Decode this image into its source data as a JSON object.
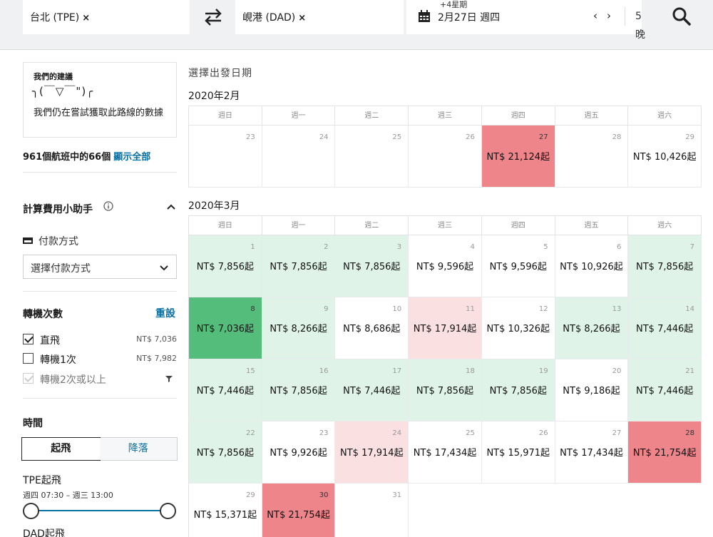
{
  "search": {
    "origin": "台北 (TPE)",
    "destination": "峴港 (DAD)",
    "remove_glyph": "×",
    "date_sup": "+4星期",
    "date_main": "2月27日 週四",
    "prev": "‹",
    "next": "›",
    "nights": "5晚"
  },
  "suggestion": {
    "title": "我們的建議",
    "face": "╮(￣▽￣\")╭",
    "message": "我們仍在嘗試獲取此路線的數據"
  },
  "results": {
    "count": "961個航班中的66個",
    "show_all": "顯示全部"
  },
  "calculator": {
    "title": "計算費用小助手",
    "payment_label": "付款方式",
    "payment_placeholder": "選擇付款方式"
  },
  "stops": {
    "title": "轉機次數",
    "reset": "重設",
    "options": [
      {
        "label": "直飛",
        "price": "NT$ 7,036",
        "checked": true
      },
      {
        "label": "轉機1次",
        "price": "NT$ 7,982",
        "checked": false
      },
      {
        "label": "轉機2次或以上",
        "price": "",
        "checked": true
      }
    ]
  },
  "time": {
    "title": "時間",
    "tab_depart": "起飛",
    "tab_arrive": "降落",
    "tpe_label": "TPE起飛",
    "tpe_range": "週四 07:30 – 週三 13:00",
    "dad_label": "DAD起飛"
  },
  "calendar": {
    "heading": "選擇出發日期",
    "weekdays": [
      "週日",
      "週一",
      "週二",
      "週三",
      "週四",
      "週五",
      "週六"
    ],
    "months": [
      {
        "title": "2020年2月",
        "weeks": [
          [
            {
              "day": "23",
              "price": "",
              "level": "none"
            },
            {
              "day": "24",
              "price": "",
              "level": "none"
            },
            {
              "day": "25",
              "price": "",
              "level": "none"
            },
            {
              "day": "26",
              "price": "",
              "level": "none"
            },
            {
              "day": "27",
              "price": "NT$ 21,124起",
              "level": "red"
            },
            {
              "day": "28",
              "price": "",
              "level": "none"
            },
            {
              "day": "29",
              "price": "NT$ 10,426起",
              "level": "none"
            }
          ]
        ]
      },
      {
        "title": "2020年3月",
        "weeks": [
          [
            {
              "day": "1",
              "price": "NT$ 7,856起",
              "level": "green"
            },
            {
              "day": "2",
              "price": "NT$ 7,856起",
              "level": "green"
            },
            {
              "day": "3",
              "price": "NT$ 7,856起",
              "level": "green"
            },
            {
              "day": "4",
              "price": "NT$ 9,596起",
              "level": "none"
            },
            {
              "day": "5",
              "price": "NT$ 9,596起",
              "level": "none"
            },
            {
              "day": "6",
              "price": "NT$ 10,926起",
              "level": "none"
            },
            {
              "day": "7",
              "price": "NT$ 7,856起",
              "level": "green"
            }
          ],
          [
            {
              "day": "8",
              "price": "NT$ 7,036起",
              "level": "dgreen"
            },
            {
              "day": "9",
              "price": "NT$ 8,266起",
              "level": "green"
            },
            {
              "day": "10",
              "price": "NT$ 8,686起",
              "level": "none"
            },
            {
              "day": "11",
              "price": "NT$ 17,914起",
              "level": "pink"
            },
            {
              "day": "12",
              "price": "NT$ 10,326起",
              "level": "none"
            },
            {
              "day": "13",
              "price": "NT$ 8,266起",
              "level": "green"
            },
            {
              "day": "14",
              "price": "NT$ 7,446起",
              "level": "green"
            }
          ],
          [
            {
              "day": "15",
              "price": "NT$ 7,446起",
              "level": "green"
            },
            {
              "day": "16",
              "price": "NT$ 7,856起",
              "level": "green"
            },
            {
              "day": "17",
              "price": "NT$ 7,446起",
              "level": "green"
            },
            {
              "day": "18",
              "price": "NT$ 7,856起",
              "level": "green"
            },
            {
              "day": "19",
              "price": "NT$ 7,856起",
              "level": "green"
            },
            {
              "day": "20",
              "price": "NT$ 9,186起",
              "level": "none"
            },
            {
              "day": "21",
              "price": "NT$ 7,446起",
              "level": "green"
            }
          ],
          [
            {
              "day": "22",
              "price": "NT$ 7,856起",
              "level": "green"
            },
            {
              "day": "23",
              "price": "NT$ 9,926起",
              "level": "none"
            },
            {
              "day": "24",
              "price": "NT$ 17,914起",
              "level": "pink"
            },
            {
              "day": "25",
              "price": "NT$ 17,434起",
              "level": "none"
            },
            {
              "day": "26",
              "price": "NT$ 15,971起",
              "level": "none"
            },
            {
              "day": "27",
              "price": "NT$ 17,434起",
              "level": "none"
            },
            {
              "day": "28",
              "price": "NT$ 21,754起",
              "level": "red"
            }
          ],
          [
            {
              "day": "29",
              "price": "NT$ 15,371起",
              "level": "none"
            },
            {
              "day": "30",
              "price": "NT$ 21,754起",
              "level": "red"
            },
            {
              "day": "31",
              "price": "",
              "level": "none"
            },
            {
              "day": "",
              "price": "",
              "level": "empty"
            },
            {
              "day": "",
              "price": "",
              "level": "empty"
            },
            {
              "day": "",
              "price": "",
              "level": "empty"
            },
            {
              "day": "",
              "price": "",
              "level": "empty"
            }
          ]
        ]
      }
    ]
  },
  "colors": {
    "accent": "#0770a3",
    "cheap": "#dff3e8",
    "cheapest": "#55bd7c",
    "expensive": "#ed858a",
    "pricier": "#fbe0e1"
  },
  "icons": [
    "remove-icon",
    "swap-icon",
    "calendar-icon",
    "search-icon",
    "info-icon",
    "chevron-up-icon",
    "card-icon",
    "chevron-down-icon",
    "filter-icon",
    "check-icon"
  ]
}
